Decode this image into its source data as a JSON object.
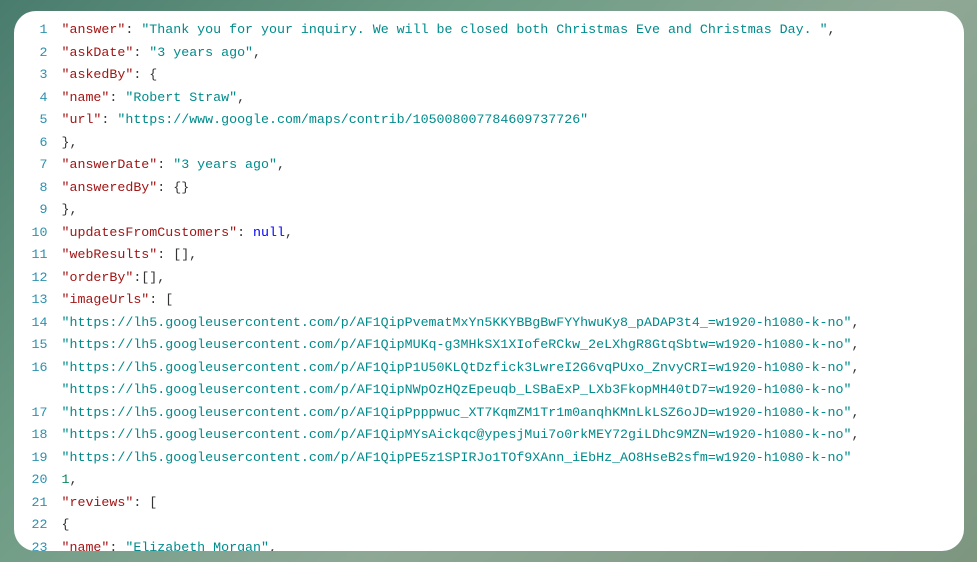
{
  "lines": [
    {
      "n": "1",
      "tokens": [
        {
          "t": "\"answer\"",
          "c": "key"
        },
        {
          "t": ": ",
          "c": "punct"
        },
        {
          "t": "\"Thank you for your inquiry. We will be closed both Christmas Eve and Christmas Day. \"",
          "c": "string"
        },
        {
          "t": ",",
          "c": "punct"
        }
      ]
    },
    {
      "n": "2",
      "tokens": [
        {
          "t": "\"askDate\"",
          "c": "key"
        },
        {
          "t": ": ",
          "c": "punct"
        },
        {
          "t": "\"3 years ago\"",
          "c": "string"
        },
        {
          "t": ",",
          "c": "punct"
        }
      ]
    },
    {
      "n": "3",
      "tokens": [
        {
          "t": "\"askedBy\"",
          "c": "key"
        },
        {
          "t": ": {",
          "c": "punct"
        }
      ]
    },
    {
      "n": "4",
      "tokens": [
        {
          "t": "\"name\"",
          "c": "key"
        },
        {
          "t": ": ",
          "c": "punct"
        },
        {
          "t": "\"Robert Straw\"",
          "c": "string"
        },
        {
          "t": ",",
          "c": "punct"
        }
      ]
    },
    {
      "n": "5",
      "tokens": [
        {
          "t": "\"url\"",
          "c": "key"
        },
        {
          "t": ": ",
          "c": "punct"
        },
        {
          "t": "\"https://www.google.com/maps/contrib/105008007784609737726\"",
          "c": "string"
        }
      ]
    },
    {
      "n": "6",
      "tokens": [
        {
          "t": "},",
          "c": "punct"
        }
      ]
    },
    {
      "n": "7",
      "tokens": [
        {
          "t": "\"answerDate\"",
          "c": "key"
        },
        {
          "t": ": ",
          "c": "punct"
        },
        {
          "t": "\"3 years ago\"",
          "c": "string"
        },
        {
          "t": ",",
          "c": "punct"
        }
      ]
    },
    {
      "n": "8",
      "tokens": [
        {
          "t": "\"answeredBy\"",
          "c": "key"
        },
        {
          "t": ": {}",
          "c": "punct"
        }
      ]
    },
    {
      "n": "9",
      "tokens": [
        {
          "t": "},",
          "c": "punct"
        }
      ]
    },
    {
      "n": "10",
      "tokens": [
        {
          "t": "\"updatesFromCustomers\"",
          "c": "key"
        },
        {
          "t": ": ",
          "c": "punct"
        },
        {
          "t": "null",
          "c": "null"
        },
        {
          "t": ",",
          "c": "punct"
        }
      ]
    },
    {
      "n": "11",
      "tokens": [
        {
          "t": "\"webResults\"",
          "c": "key"
        },
        {
          "t": ": [],",
          "c": "punct"
        }
      ]
    },
    {
      "n": "12",
      "tokens": [
        {
          "t": "\"orderBy\"",
          "c": "key"
        },
        {
          "t": ":[],",
          "c": "punct"
        }
      ]
    },
    {
      "n": "13",
      "tokens": [
        {
          "t": "\"imageUrls\"",
          "c": "key"
        },
        {
          "t": ": [",
          "c": "punct"
        }
      ]
    },
    {
      "n": "14",
      "tokens": [
        {
          "t": "\"https://lh5.googleusercontent.com/p/AF1QipPvematMxYn5KKYBBgBwFYYhwuKy8_pADAP3t4_=w1920-h1080-k-no\"",
          "c": "string"
        },
        {
          "t": ",",
          "c": "punct"
        }
      ]
    },
    {
      "n": "15",
      "tokens": [
        {
          "t": "\"https://lh5.googleusercontent.com/p/AF1QipMUKq-g3MHkSX1XIofeRCkw_2eLXhgR8GtqSbtw=w1920-h1080-k-no\"",
          "c": "string"
        },
        {
          "t": ",",
          "c": "punct"
        }
      ]
    },
    {
      "n": "16",
      "tokens": [
        {
          "t": "\"https://lh5.googleusercontent.com/p/AF1QipP1U50KLQtDzfick3LwreI2G6vqPUxo_ZnvyCRI=w1920-h1080-k-no\"",
          "c": "string"
        },
        {
          "t": ",",
          "c": "punct"
        }
      ]
    },
    {
      "n": "16b",
      "tokens": [
        {
          "t": "\"https://lh5.googleusercontent.com/p/AF1QipNWpOzHQzEpeuqb_LSBaExP_LXb3FkopMH40tD7=w1920-h1080-k-no\"",
          "c": "string"
        }
      ],
      "hideNum": true
    },
    {
      "n": "17",
      "tokens": [
        {
          "t": "\"https://lh5.googleusercontent.com/p/AF1QipPpppwuc_XT7KqmZM1Tr1m0anqhKMnLkLSZ6oJD=w1920-h1080-k-no\"",
          "c": "string"
        },
        {
          "t": ",",
          "c": "punct"
        }
      ]
    },
    {
      "n": "18",
      "tokens": [
        {
          "t": "\"https://lh5.googleusercontent.com/p/AF1QipMYsAickqc@ypesjMui7o0rkMEY72giLDhc9MZN=w1920-h1080-k-no\"",
          "c": "string"
        },
        {
          "t": ",",
          "c": "punct"
        }
      ]
    },
    {
      "n": "19",
      "tokens": [
        {
          "t": "\"https://lh5.googleusercontent.com/p/AF1QipPE5z1SPIRJo1TOf9XAnn_iEbHz_AO8HseB2sfm=w1920-h1080-k-no\"",
          "c": "string"
        }
      ]
    },
    {
      "n": "20",
      "tokens": [
        {
          "t": "1",
          "c": "num"
        },
        {
          "t": ",",
          "c": "punct"
        }
      ]
    },
    {
      "n": "21",
      "tokens": [
        {
          "t": "\"reviews\"",
          "c": "key"
        },
        {
          "t": ": [",
          "c": "punct"
        }
      ]
    },
    {
      "n": "22",
      "tokens": [
        {
          "t": "{",
          "c": "punct"
        }
      ]
    },
    {
      "n": "23",
      "tokens": [
        {
          "t": "\"name\"",
          "c": "key"
        },
        {
          "t": ": ",
          "c": "punct"
        },
        {
          "t": "\"Elizabeth Morgan\"",
          "c": "string"
        },
        {
          "t": ",",
          "c": "punct"
        }
      ]
    }
  ]
}
